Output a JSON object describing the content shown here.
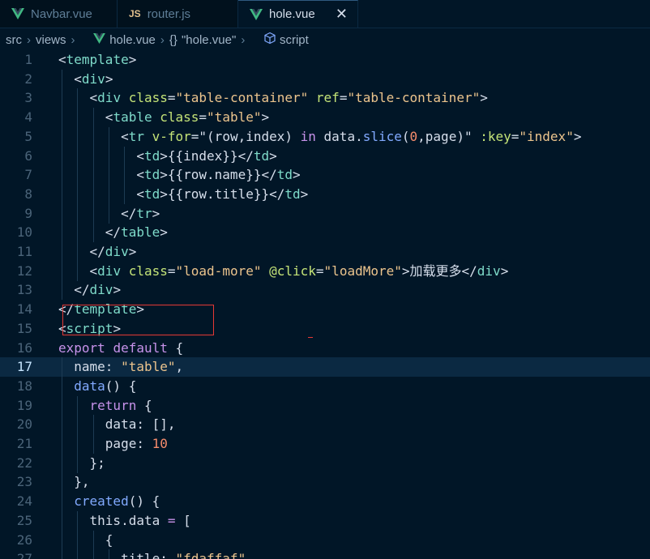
{
  "tabs": [
    {
      "label": "Navbar.vue",
      "icon": "vue-icon",
      "active": false
    },
    {
      "label": "router.js",
      "icon": "js-icon",
      "active": false
    },
    {
      "label": "hole.vue",
      "icon": "vue-icon",
      "active": true
    }
  ],
  "close_glyph": "✕",
  "js_badge": "JS",
  "breadcrumb": {
    "src": "src",
    "views": "views",
    "file": "hole.vue",
    "braces": "{}",
    "object": "\"hole.vue\"",
    "section": "script"
  },
  "colors": {
    "background": "#011627",
    "highlight_border": "#e53935",
    "current_line": "#0b2942"
  },
  "editor": {
    "current_line": 17,
    "lines": [
      {
        "n": "1",
        "indent": 0,
        "tokens": [
          [
            "t-br",
            "<"
          ],
          [
            "t-tag",
            "template"
          ],
          [
            "t-br",
            ">"
          ]
        ]
      },
      {
        "n": "2",
        "indent": 1,
        "tokens": [
          [
            "t-br",
            "<"
          ],
          [
            "t-tag",
            "div"
          ],
          [
            "t-br",
            ">"
          ]
        ]
      },
      {
        "n": "3",
        "indent": 2,
        "tokens": [
          [
            "t-br",
            "<"
          ],
          [
            "t-tag",
            "div "
          ],
          [
            "t-attr",
            "class"
          ],
          [
            "t-br",
            "="
          ],
          [
            "t-str",
            "\"table-container\" "
          ],
          [
            "t-attr",
            "ref"
          ],
          [
            "t-br",
            "="
          ],
          [
            "t-str",
            "\"table-container\""
          ],
          [
            "t-br",
            ">"
          ]
        ]
      },
      {
        "n": "4",
        "indent": 3,
        "tokens": [
          [
            "t-br",
            "<"
          ],
          [
            "t-tag",
            "table "
          ],
          [
            "t-attr",
            "class"
          ],
          [
            "t-br",
            "="
          ],
          [
            "t-str",
            "\"table\""
          ],
          [
            "t-br",
            ">"
          ]
        ]
      },
      {
        "n": "5",
        "indent": 4,
        "tokens": [
          [
            "t-br",
            "<"
          ],
          [
            "t-tag",
            "tr "
          ],
          [
            "t-attr",
            "v-for"
          ],
          [
            "t-br",
            "=\"(row,index) "
          ],
          [
            "t-kw",
            "in"
          ],
          [
            "t-br",
            " data."
          ],
          [
            "t-fn",
            "slice"
          ],
          [
            "t-br",
            "("
          ],
          [
            "t-num",
            "0"
          ],
          [
            "t-br",
            ",page)\" "
          ],
          [
            "t-attr",
            ":key"
          ],
          [
            "t-br",
            "="
          ],
          [
            "t-str",
            "\"index\""
          ],
          [
            "t-br",
            ">"
          ]
        ]
      },
      {
        "n": "6",
        "indent": 5,
        "tokens": [
          [
            "t-br",
            "<"
          ],
          [
            "t-tag",
            "td"
          ],
          [
            "t-br",
            ">{{index}}</"
          ],
          [
            "t-tag",
            "td"
          ],
          [
            "t-br",
            ">"
          ]
        ]
      },
      {
        "n": "7",
        "indent": 5,
        "tokens": [
          [
            "t-br",
            "<"
          ],
          [
            "t-tag",
            "td"
          ],
          [
            "t-br",
            ">{{row.name}}</"
          ],
          [
            "t-tag",
            "td"
          ],
          [
            "t-br",
            ">"
          ]
        ]
      },
      {
        "n": "8",
        "indent": 5,
        "tokens": [
          [
            "t-br",
            "<"
          ],
          [
            "t-tag",
            "td"
          ],
          [
            "t-br",
            ">{{row.title}}</"
          ],
          [
            "t-tag",
            "td"
          ],
          [
            "t-br",
            ">"
          ]
        ]
      },
      {
        "n": "9",
        "indent": 4,
        "tokens": [
          [
            "t-br",
            "</"
          ],
          [
            "t-tag",
            "tr"
          ],
          [
            "t-br",
            ">"
          ]
        ]
      },
      {
        "n": "10",
        "indent": 3,
        "tokens": [
          [
            "t-br",
            "</"
          ],
          [
            "t-tag",
            "table"
          ],
          [
            "t-br",
            ">"
          ]
        ]
      },
      {
        "n": "11",
        "indent": 2,
        "tokens": [
          [
            "t-br",
            "</"
          ],
          [
            "t-tag",
            "div"
          ],
          [
            "t-br",
            ">"
          ]
        ]
      },
      {
        "n": "12",
        "indent": 2,
        "tokens": [
          [
            "t-br",
            "<"
          ],
          [
            "t-tag",
            "div "
          ],
          [
            "t-attr",
            "class"
          ],
          [
            "t-br",
            "="
          ],
          [
            "t-str",
            "\"load-more\" "
          ],
          [
            "t-attr",
            "@click"
          ],
          [
            "t-br",
            "="
          ],
          [
            "t-str",
            "\"loadMore\""
          ],
          [
            "t-br",
            ">加载更多</"
          ],
          [
            "t-tag",
            "div"
          ],
          [
            "t-br",
            ">"
          ]
        ]
      },
      {
        "n": "13",
        "indent": 1,
        "tokens": [
          [
            "t-br",
            "</"
          ],
          [
            "t-tag",
            "div"
          ],
          [
            "t-br",
            ">"
          ]
        ]
      },
      {
        "n": "14",
        "indent": 0,
        "tokens": [
          [
            "t-br",
            "</"
          ],
          [
            "t-tag",
            "template"
          ],
          [
            "t-br",
            ">"
          ]
        ]
      },
      {
        "n": "15",
        "indent": 0,
        "tokens": [
          [
            "t-br",
            "<"
          ],
          [
            "t-tag",
            "script"
          ],
          [
            "t-br",
            ">"
          ]
        ]
      },
      {
        "n": "16",
        "indent": 0,
        "tokens": [
          [
            "t-ctrl",
            "export "
          ],
          [
            "t-ctrl",
            "default"
          ],
          [
            "t-br",
            " {"
          ]
        ]
      },
      {
        "n": "17",
        "indent": 1,
        "tokens": [
          [
            "t-txt",
            "name: "
          ],
          [
            "t-str",
            "\"table\""
          ],
          [
            "t-br",
            ","
          ]
        ]
      },
      {
        "n": "18",
        "indent": 1,
        "tokens": [
          [
            "t-fn",
            "data"
          ],
          [
            "t-br",
            "() {"
          ]
        ]
      },
      {
        "n": "19",
        "indent": 2,
        "tokens": [
          [
            "t-ctrl",
            "return"
          ],
          [
            "t-br",
            " {"
          ]
        ]
      },
      {
        "n": "20",
        "indent": 3,
        "tokens": [
          [
            "t-txt",
            "data: [],"
          ]
        ]
      },
      {
        "n": "21",
        "indent": 3,
        "tokens": [
          [
            "t-txt",
            "page: "
          ],
          [
            "t-num",
            "10"
          ]
        ]
      },
      {
        "n": "22",
        "indent": 2,
        "tokens": [
          [
            "t-br",
            "};"
          ]
        ]
      },
      {
        "n": "23",
        "indent": 1,
        "tokens": [
          [
            "t-br",
            "},"
          ]
        ]
      },
      {
        "n": "24",
        "indent": 1,
        "tokens": [
          [
            "t-fn",
            "created"
          ],
          [
            "t-br",
            "() {"
          ]
        ]
      },
      {
        "n": "25",
        "indent": 2,
        "tokens": [
          [
            "t-txt",
            "this.data "
          ],
          [
            "t-kw",
            "="
          ],
          [
            "t-br",
            " ["
          ]
        ]
      },
      {
        "n": "26",
        "indent": 3,
        "tokens": [
          [
            "t-br",
            "{"
          ]
        ]
      },
      {
        "n": "27",
        "indent": 4,
        "tokens": [
          [
            "t-txt",
            "title: "
          ],
          [
            "t-str",
            "\"fdaffaf\","
          ]
        ]
      }
    ]
  }
}
